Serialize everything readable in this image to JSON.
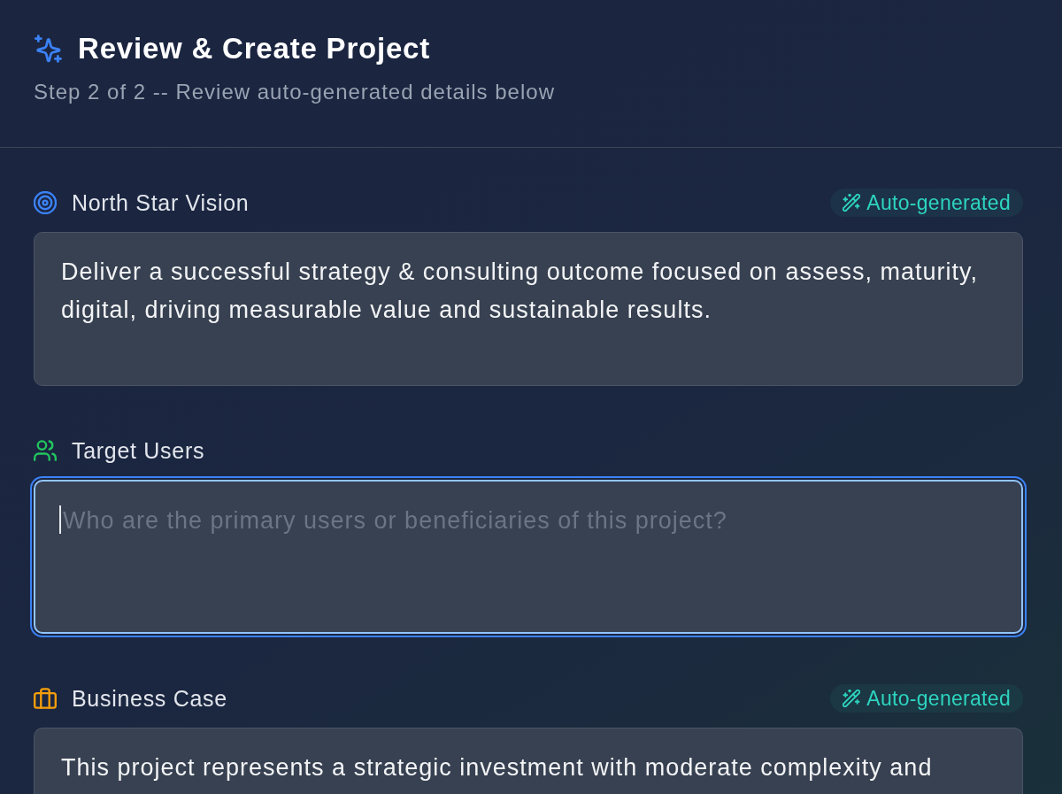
{
  "header": {
    "title": "Review & Create Project",
    "subtitle": "Step 2 of 2 -- Review auto-generated details below"
  },
  "sections": [
    {
      "label": "North Star Vision",
      "color": "#3b82f6",
      "badge": "Auto-generated",
      "value": "Deliver a successful strategy & consulting outcome focused on assess, maturity, digital, driving measurable value and sustainable results.",
      "focused": false
    },
    {
      "label": "Target Users",
      "color": "#22c55e",
      "placeholder": "Who are the primary users or beneficiaries of this project?",
      "focused": true
    },
    {
      "label": "Business Case",
      "color": "#f59e0b",
      "badge": "Auto-generated",
      "value": "This project represents a strategic investment with moderate complexity and",
      "focused": false
    }
  ]
}
